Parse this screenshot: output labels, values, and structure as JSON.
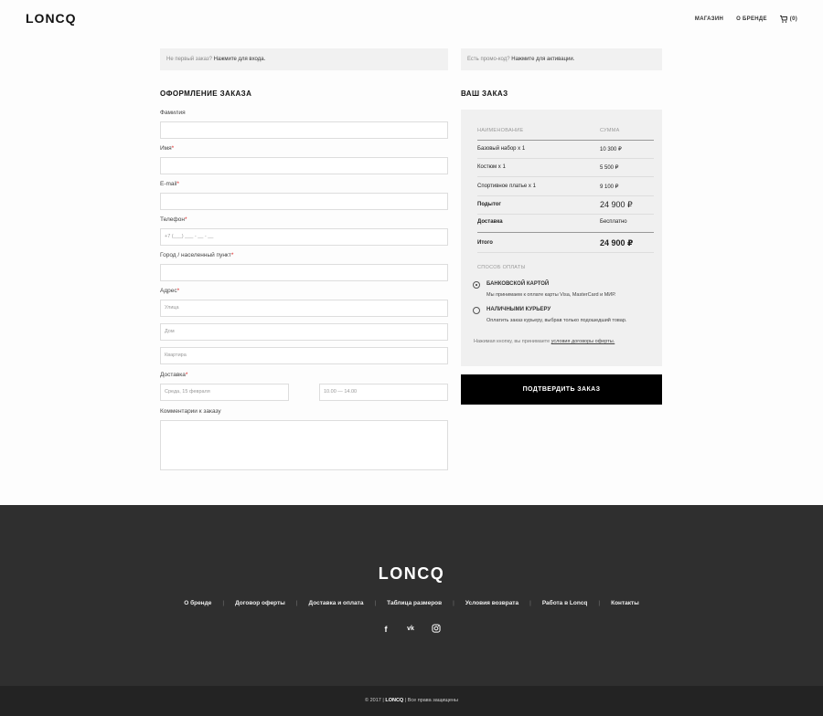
{
  "header": {
    "logo": "LONCQ",
    "nav": {
      "shop": "МАГАЗИН",
      "about": "О БРЕНДЕ",
      "cart_count": "(0)"
    }
  },
  "notices": {
    "login_question": "Не первый заказ?",
    "login_action": "Нажмите для входа.",
    "promo_question": "Есть промо-код?",
    "promo_action": "Нажмите для активации."
  },
  "checkout": {
    "title": "ОФОРМЛЕНИЕ ЗАКАЗА",
    "lastname_label": "Фамилия",
    "firstname_label": "Имя",
    "email_label": "E-mail",
    "phone_label": "Телефон",
    "phone_placeholder": "+7 (___) ___ - __ - __",
    "city_label": "Город / населенный пункт",
    "address_label": "Адрес",
    "street_placeholder": "Улица",
    "house_placeholder": "Дом",
    "apt_placeholder": "Квартира",
    "delivery_label": "Доставка",
    "delivery_date": "Среда, 15 февраля",
    "delivery_time": "10.00 — 14.00",
    "comment_label": "Комментарии к заказу",
    "required_mark": "*"
  },
  "order": {
    "title": "ВАШ ЗАКАЗ",
    "col_name": "НАИМЕНОВАНИЕ",
    "col_sum": "СУММА",
    "items": [
      {
        "name": "Базовый набор x 1",
        "price": "10 300 ₽"
      },
      {
        "name": "Костюм x 1",
        "price": "5 500 ₽"
      },
      {
        "name": "Спортивное платье x 1",
        "price": "9 100 ₽"
      }
    ],
    "subtotal_label": "Подытог",
    "subtotal_value": "24 900 ₽",
    "delivery_label": "Доставка",
    "delivery_value": "Бесплатно",
    "total_label": "Итого",
    "total_value": "24 900 ₽",
    "payment_title": "СПОСОБ ОПЛАТЫ",
    "pay_card_name": "БАНКОВСКОЙ КАРТОЙ",
    "pay_card_desc": "Мы принимаем к оплате карты Visa, MasterCard и МИР.",
    "pay_cash_name": "НАЛИЧНЫМИ КУРЬЕРУ",
    "pay_cash_desc": "Оплатить заказ курьеру, выбрав только подошедший товар.",
    "agree_text": "Нажимая кнопку, вы принимаете",
    "agree_link": "условия договоры оферты.",
    "confirm_button": "ПОДТВЕРДИТЬ ЗАКАЗ"
  },
  "footer": {
    "logo": "LONCQ",
    "links": [
      "О бренде",
      "Договор оферты",
      "Доставка и оплата",
      "Таблица размеров",
      "Условия возврата",
      "Работа в Loncq",
      "Контакты"
    ],
    "separator": "|",
    "social": {
      "fb": "f",
      "vk": "vk"
    },
    "copyright_pre": "© 2017 |",
    "copyright_brand": "LONCQ",
    "copyright_post": "| Все права защищены"
  }
}
